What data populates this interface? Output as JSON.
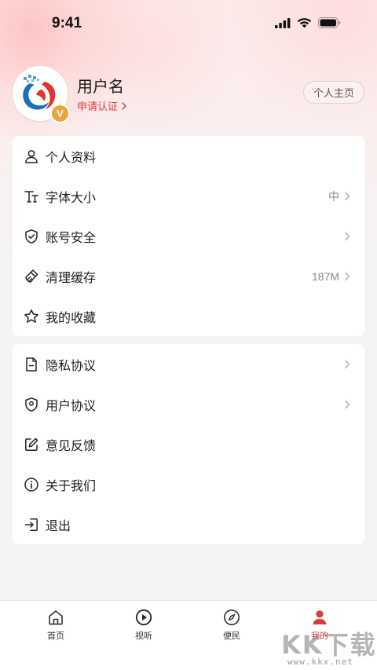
{
  "status_bar": {
    "time": "9:41"
  },
  "profile": {
    "username": "用户名",
    "apply_label": "申请认证",
    "badge": "V",
    "homepage_button": "个人主页"
  },
  "menu_group_1": [
    {
      "label": "个人资料",
      "icon": "person-icon",
      "value": ""
    },
    {
      "label": "字体大小",
      "icon": "font-size-icon",
      "value": "中"
    },
    {
      "label": "账号安全",
      "icon": "shield-check-icon",
      "value": ""
    },
    {
      "label": "清理缓存",
      "icon": "broom-icon",
      "value": "187M"
    },
    {
      "label": "我的收藏",
      "icon": "star-icon",
      "value": ""
    }
  ],
  "menu_group_2": [
    {
      "label": "隐私协议",
      "icon": "document-icon",
      "value": ""
    },
    {
      "label": "用户协议",
      "icon": "shield-location-icon",
      "value": ""
    },
    {
      "label": "意见反馈",
      "icon": "edit-icon",
      "value": ""
    },
    {
      "label": "关于我们",
      "icon": "info-icon",
      "value": ""
    },
    {
      "label": "退出",
      "icon": "logout-icon",
      "value": ""
    }
  ],
  "tabs": [
    {
      "label": "首页",
      "icon": "home-icon"
    },
    {
      "label": "视听",
      "icon": "play-icon"
    },
    {
      "label": "便民",
      "icon": "compass-icon"
    },
    {
      "label": "我的",
      "icon": "user-icon"
    }
  ],
  "colors": {
    "accent": "#e03a3a",
    "badge": "#f0a23a"
  },
  "watermark": {
    "big": "KK下载",
    "small": "www.kkx.net"
  }
}
